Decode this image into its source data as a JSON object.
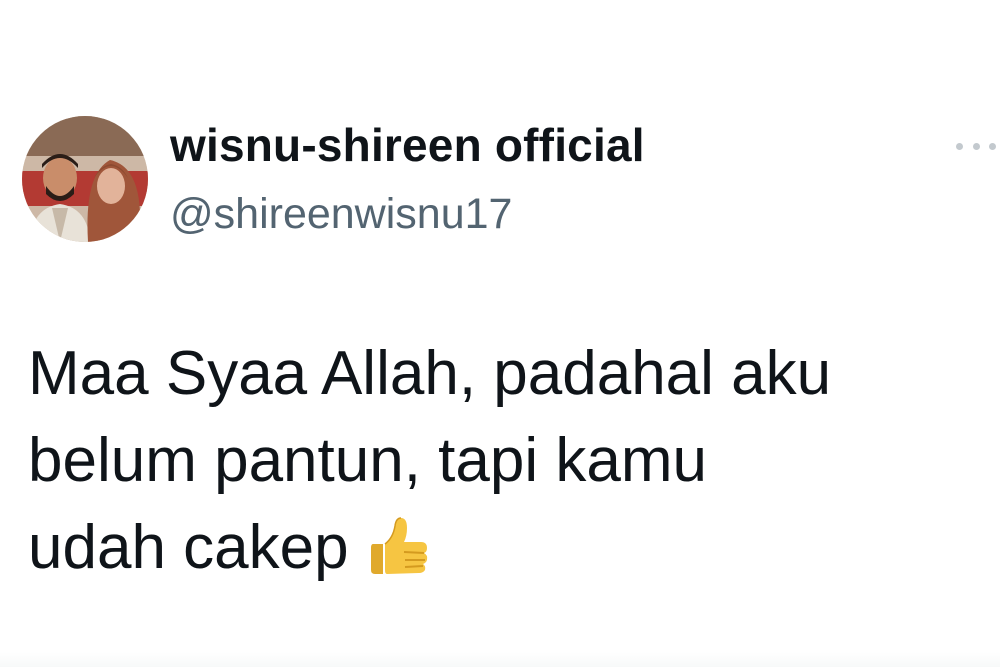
{
  "tweet": {
    "author": {
      "display_name": "wisnu-shireen official",
      "handle": "@shireenwisnu17",
      "avatar_icon": "profile-photo"
    },
    "text_lines": [
      "Maa Syaa Allah, padahal aku",
      "belum pantun, tapi kamu",
      "udah cakep"
    ],
    "emoji": "thumbs-up",
    "more_icon": "ellipsis-icon"
  },
  "colors": {
    "name": "#0f1419",
    "handle": "#536471",
    "body_text": "#0f1419",
    "more_dots": "#c3c9ce",
    "emoji_yellow": "#f6c542"
  }
}
